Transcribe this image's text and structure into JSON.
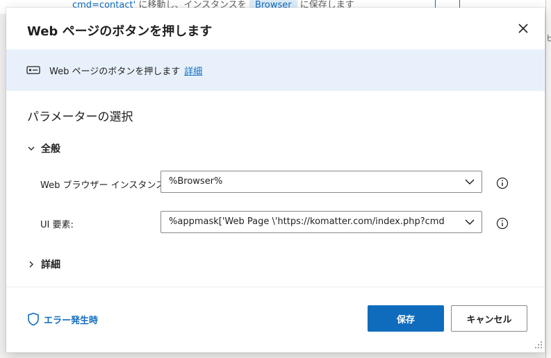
{
  "background": {
    "text_link": "cmd=contact'",
    "text_mid": " に移動し、インスタンスを",
    "text_chip": "Browser",
    "text_end": " に保存します",
    "right_glyph": "ビ"
  },
  "dialog": {
    "title": "Web ページのボタンを押します",
    "close_icon": "close-icon",
    "banner": {
      "icon": "button-icon",
      "text": "Web ページのボタンを押します",
      "link": "詳細"
    },
    "section_title": "パラメーターの選択",
    "groups": {
      "general": {
        "label": "全般",
        "expanded": true
      },
      "advanced": {
        "label": "詳細",
        "expanded": false
      }
    },
    "fields": [
      {
        "label": "Web ブラウザー インスタンス:",
        "value": "%Browser%"
      },
      {
        "label": "UI 要素:",
        "value": "%appmask['Web Page \\'https://komatter.com/index.php?cmd"
      }
    ],
    "footer": {
      "on_error_label": "エラー発生時",
      "save_label": "保存",
      "cancel_label": "キャンセル"
    }
  },
  "colors": {
    "accent": "#0f6cbd",
    "banner_bg": "#e8f1fb",
    "border": "#8a8886"
  }
}
